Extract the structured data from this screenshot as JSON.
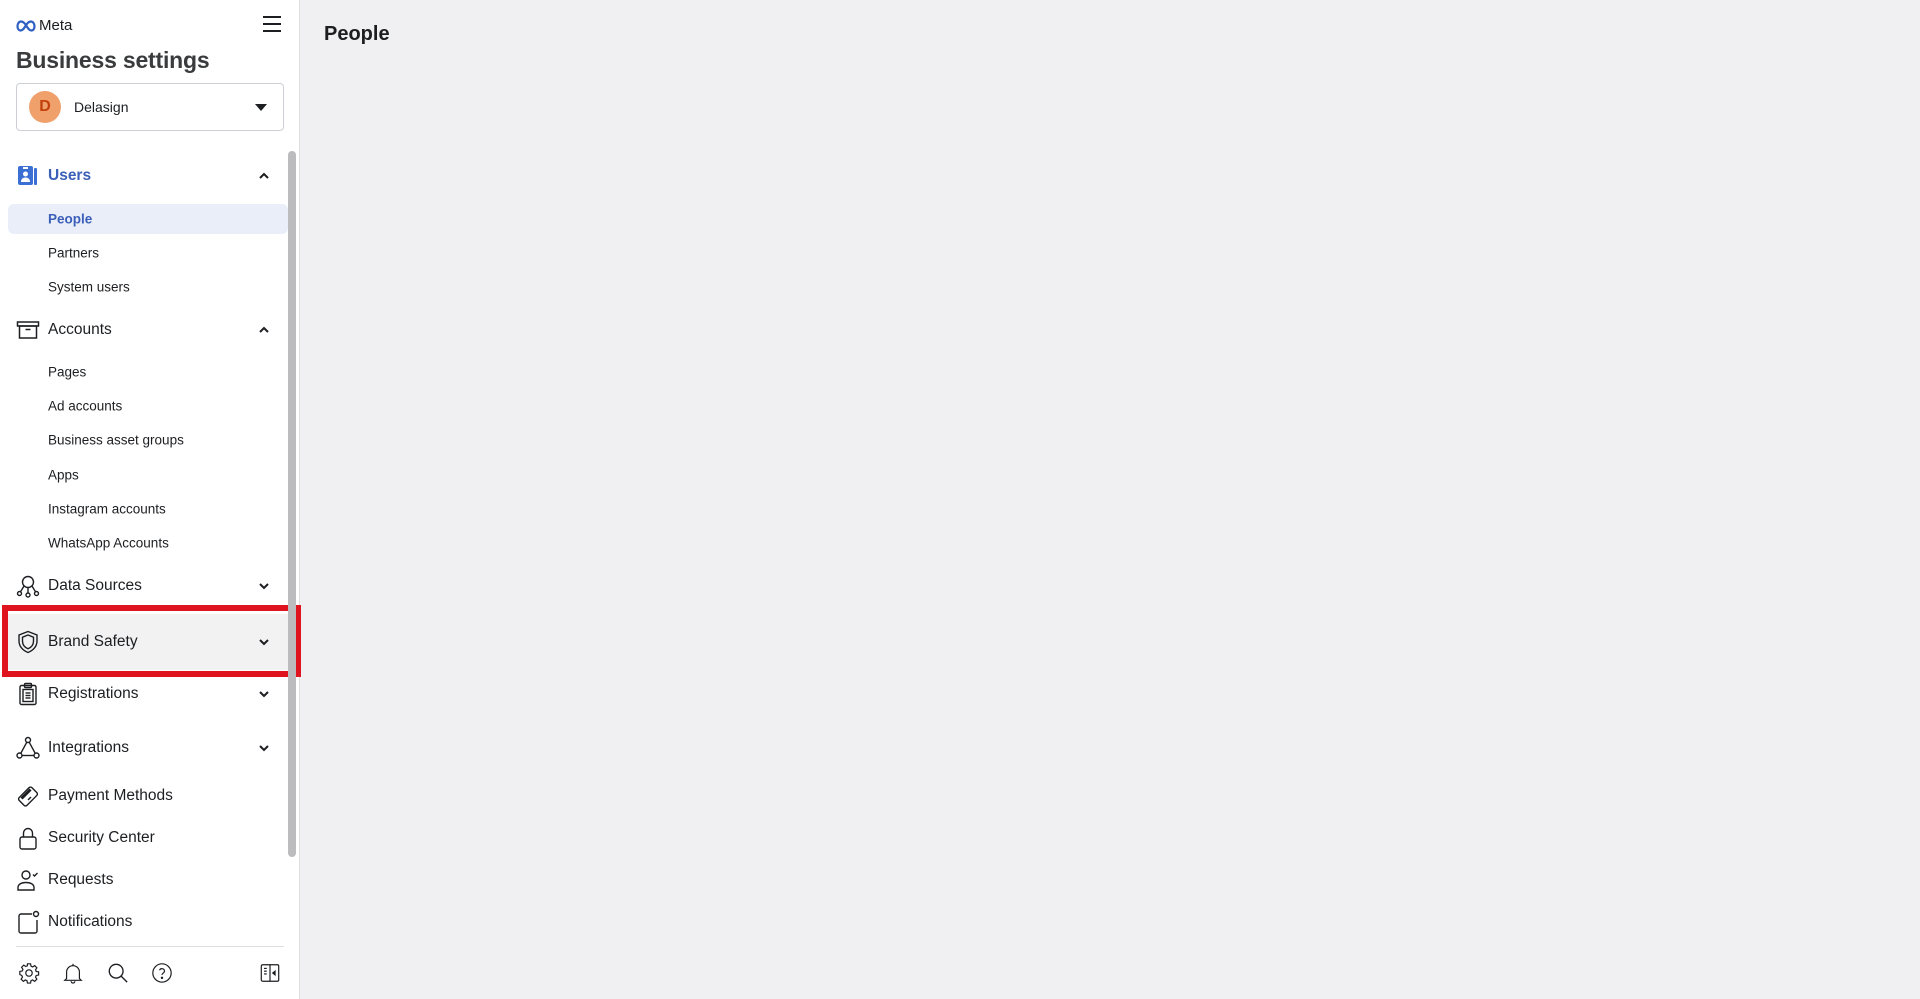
{
  "brand": {
    "logo_text": "Meta"
  },
  "sidebar": {
    "title": "Business settings",
    "account": {
      "initial": "D",
      "name": "Delasign",
      "avatar_color": "#f0a06a"
    },
    "sections": [
      {
        "label": "Users",
        "icon": "users-badge-icon",
        "expanded": true,
        "active": true,
        "items": [
          {
            "label": "People",
            "selected": true
          },
          {
            "label": "Partners"
          },
          {
            "label": "System users"
          }
        ]
      },
      {
        "label": "Accounts",
        "icon": "archive-box-icon",
        "expanded": true,
        "items": [
          {
            "label": "Pages"
          },
          {
            "label": "Ad accounts"
          },
          {
            "label": "Business asset groups"
          },
          {
            "label": "Apps"
          },
          {
            "label": "Instagram accounts"
          },
          {
            "label": "WhatsApp Accounts"
          }
        ]
      },
      {
        "label": "Data Sources",
        "icon": "data-sources-icon",
        "expanded": false
      },
      {
        "label": "Brand Safety",
        "icon": "shield-icon",
        "expanded": false,
        "highlighted": true
      },
      {
        "label": "Registrations",
        "icon": "clipboard-icon",
        "expanded": false
      },
      {
        "label": "Integrations",
        "icon": "integrations-icon",
        "expanded": false
      },
      {
        "label": "Payment Methods",
        "icon": "credit-card-icon"
      },
      {
        "label": "Security Center",
        "icon": "lock-icon"
      },
      {
        "label": "Requests",
        "icon": "person-check-icon"
      },
      {
        "label": "Notifications",
        "icon": "notification-icon"
      }
    ],
    "bottom_icons": [
      "settings-gear-icon",
      "bell-icon",
      "search-icon",
      "help-icon",
      "collapse-panel-icon"
    ]
  },
  "main": {
    "title": "People"
  },
  "colors": {
    "accent": "#3b5fb8",
    "selected_bg": "#e9eef9",
    "highlight": "#e0141e",
    "page_bg": "#f0eff1"
  }
}
